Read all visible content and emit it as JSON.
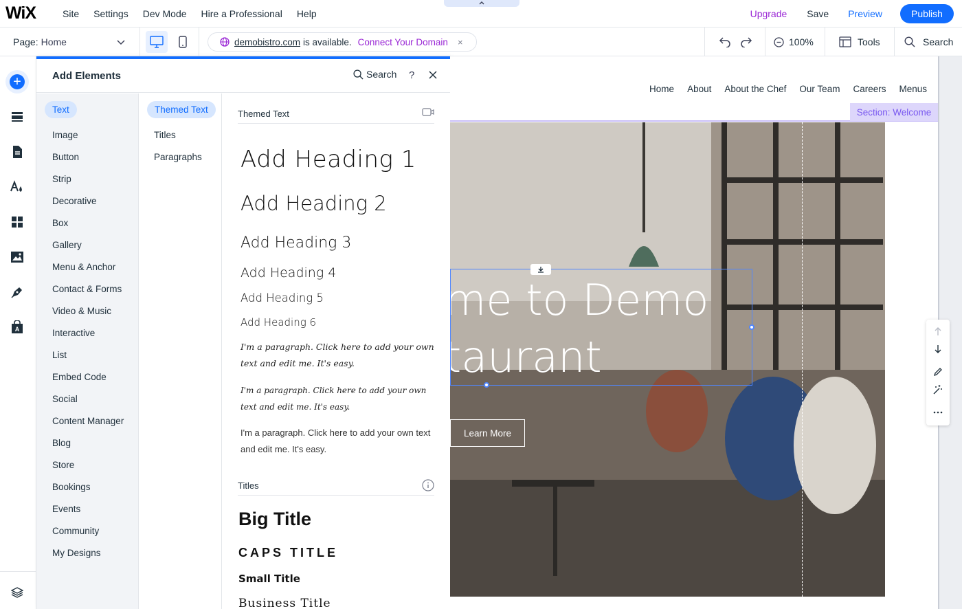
{
  "top_bar": {
    "logo": "WiX",
    "nav": [
      "Site",
      "Settings",
      "Dev Mode",
      "Hire a Professional",
      "Help"
    ],
    "upgrade": "Upgrade",
    "save": "Save",
    "preview": "Preview",
    "publish": "Publish"
  },
  "sub_bar": {
    "page_label": "Page:",
    "page_value": "Home",
    "domain_name": "demobistro.com",
    "domain_status": "is available.",
    "connect_domain": "Connect Your Domain",
    "close": "×",
    "zoom": "100%",
    "tools": "Tools",
    "search": "Search"
  },
  "panel": {
    "title": "Add Elements",
    "search": "Search",
    "help": "?",
    "categories": [
      "Text",
      "Image",
      "Button",
      "Strip",
      "Decorative",
      "Box",
      "Gallery",
      "Menu & Anchor",
      "Contact & Forms",
      "Video & Music",
      "Interactive",
      "List",
      "Embed Code",
      "Social",
      "Content Manager",
      "Blog",
      "Store",
      "Bookings",
      "Events",
      "Community",
      "My Designs"
    ],
    "active_category": "Text",
    "subcategories": [
      "Themed Text",
      "Titles",
      "Paragraphs"
    ],
    "active_subcategory": "Themed Text",
    "themed_text_header": "Themed Text",
    "headings": [
      "Add Heading 1",
      "Add Heading 2",
      "Add Heading 3",
      "Add Heading 4",
      "Add Heading 5",
      "Add Heading 6"
    ],
    "paragraphs": [
      "I'm a paragraph. Click here to add your own text and edit me. It's easy.",
      "I'm a paragraph. Click here to add your own text and edit me. It's easy.",
      "I'm a paragraph. Click here to add your own text and edit me. It's easy."
    ],
    "titles_header": "Titles",
    "titles": [
      "Big Title",
      "CAPS TITLE",
      "Small Title",
      "Business Title"
    ]
  },
  "site": {
    "nav": [
      "Home",
      "About",
      "About the Chef",
      "Our Team",
      "Careers",
      "Menus"
    ],
    "section_tag": "Section: Welcome",
    "hero_line1": "me to Demo",
    "hero_line2": "taurant",
    "learn_more": "Learn More"
  },
  "colors": {
    "accent": "#116dff",
    "upgrade": "#9a27d5",
    "section_tag_bg": "#ddd6fb",
    "section_tag_text": "#7a59f0"
  }
}
